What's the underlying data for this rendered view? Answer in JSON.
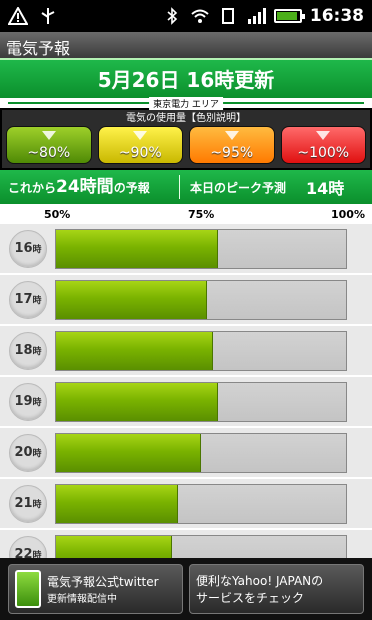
{
  "status_bar": {
    "time": "16:38"
  },
  "app": {
    "title": "電気予報"
  },
  "header": {
    "update_text": "5月26日 16時更新",
    "area": "東京電力 エリア"
  },
  "legend": {
    "title": "電気の使用量【色別説明】",
    "chips": [
      {
        "label": "~80%",
        "color": "#6aa112"
      },
      {
        "label": "~90%",
        "color": "#e6d400"
      },
      {
        "label": "~95%",
        "color": "#ff9400"
      },
      {
        "label": "~100%",
        "color": "#ff3030"
      }
    ]
  },
  "forecast": {
    "prefix": "これから",
    "hours": "24時間",
    "suffix": "の予報",
    "peak_label": "本日のピーク予測",
    "peak_value": "14時"
  },
  "scale": {
    "p50": "50%",
    "p75": "75%",
    "p100": "100%"
  },
  "rows": [
    {
      "hour": "16",
      "unit": "時",
      "percent": 78
    },
    {
      "hour": "17",
      "unit": "時",
      "percent": 76
    },
    {
      "hour": "18",
      "unit": "時",
      "percent": 77
    },
    {
      "hour": "19",
      "unit": "時",
      "percent": 78
    },
    {
      "hour": "20",
      "unit": "時",
      "percent": 75
    },
    {
      "hour": "21",
      "unit": "時",
      "percent": 71
    },
    {
      "hour": "22",
      "unit": "時",
      "percent": 70
    }
  ],
  "bottom": {
    "twitter_line1": "電気予報公式twitter",
    "twitter_line2": "更新情報配信中",
    "yahoo_line1": "便利なYahoo! JAPANの",
    "yahoo_line2": "サービスをチェック"
  }
}
